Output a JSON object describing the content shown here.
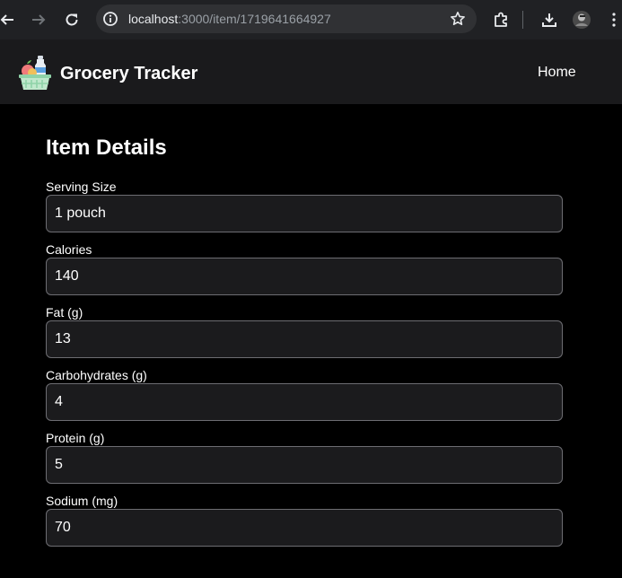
{
  "browser": {
    "url_host": "localhost",
    "url_rest": ":3000/item/1719641664927"
  },
  "header": {
    "title": "Grocery Tracker",
    "nav_home": "Home"
  },
  "page": {
    "title": "Item Details"
  },
  "fields": [
    {
      "label": "Serving Size",
      "value": "1 pouch"
    },
    {
      "label": "Calories",
      "value": "140"
    },
    {
      "label": "Fat (g)",
      "value": "13"
    },
    {
      "label": "Carbohydrates (g)",
      "value": "4"
    },
    {
      "label": "Protein (g)",
      "value": "5"
    },
    {
      "label": "Sodium (mg)",
      "value": "70"
    }
  ],
  "colors": {
    "page_bg": "#000000",
    "header_bg": "#1a1a1c",
    "input_bg": "#1b1b1d",
    "input_border": "#6d6d72",
    "browser_bg": "#202124"
  }
}
